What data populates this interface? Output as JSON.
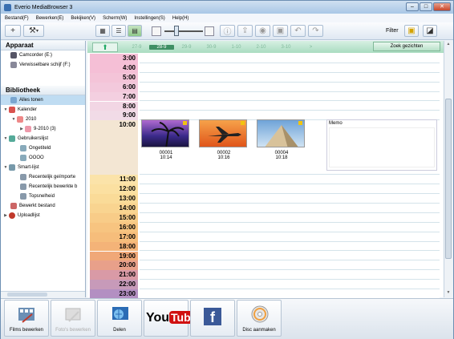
{
  "window": {
    "title": "Everio MediaBrowser 3"
  },
  "menu": [
    "Bestand(F)",
    "Bewerken(E)",
    "Bekijken(V)",
    "Scherm(W)",
    "Instellingen(S)",
    "Help(H)"
  ],
  "toolbar": {
    "filter_label": "Filter"
  },
  "sidebar": {
    "section_device": "Apparaat",
    "devices": [
      "Camcorder (E:)",
      "Verwisselbare schijf (F:)"
    ],
    "section_library": "Bibliotheek",
    "all": "Alles tonen",
    "calendar": "Kalender",
    "year": "2010",
    "month": "9-2010 (3)",
    "userlist": "Gebruikerslijst",
    "untitled": "Ongetiteld",
    "oooo": "OOOO",
    "smartlist": "Smart-lijst",
    "recent_imported": "Recentelijk geïmporte",
    "recent_edited": "Recentelijk bewerkte b",
    "top_speed": "Topsnelheid",
    "edited_file": "Bewerkt bestand",
    "upload_list": "Uploadlijst"
  },
  "datebar": {
    "dates": [
      "27-9",
      "28-9",
      "29-9",
      "30-9",
      "1-10",
      "2-10",
      "3-10",
      ">"
    ],
    "selected_index": 1,
    "find_faces": "Zoek gezichten"
  },
  "hours": [
    "3:00",
    "4:00",
    "5:00",
    "6:00",
    "7:00",
    "8:00",
    "9:00",
    "10:00",
    "11:00",
    "12:00",
    "13:00",
    "14:00",
    "15:00",
    "16:00",
    "17:00",
    "18:00",
    "19:00",
    "20:00",
    "21:00",
    "22:00",
    "23:00"
  ],
  "hour_colors": [
    "#f5bfd6",
    "#f5bfd6",
    "#f4c4d8",
    "#f3c9dc",
    "#f3cfe0",
    "#f2d6e4",
    "#f1dbe7",
    "#f3e6d3",
    "#fbe3a9",
    "#fbe0a1",
    "#fadb98",
    "#f9d490",
    "#f8cc88",
    "#f7c480",
    "#f6bd7b",
    "#f4b378",
    "#f0a878",
    "#e8a08a",
    "#d99aa6",
    "#c79ab9",
    "#b38fc2"
  ],
  "photos": [
    {
      "name": "00001",
      "time": "10:14"
    },
    {
      "name": "00002",
      "time": "10:16"
    },
    {
      "name": "00004",
      "time": "10:18"
    }
  ],
  "memo": {
    "label": "Memo"
  },
  "bottom": {
    "films": "Films bewerken",
    "photos": "Foto's bewerken",
    "share": "Delen",
    "youtube_you": "You",
    "youtube_tube": "Tube",
    "facebook": "f",
    "disc": "Disc aanmaken"
  }
}
